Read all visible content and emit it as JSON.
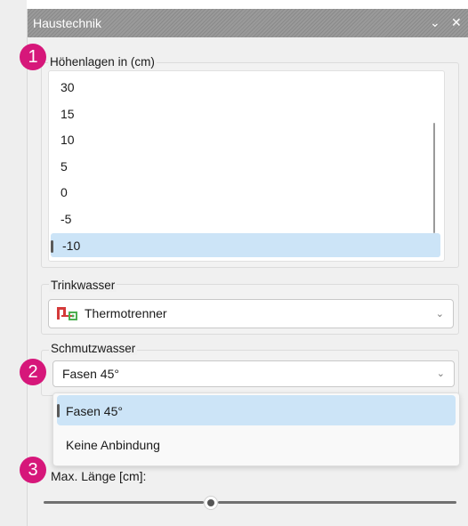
{
  "panel": {
    "title": "Haustechnik",
    "controls": {
      "pin_icon": "chevron-down-icon",
      "close_icon": "close-icon"
    }
  },
  "heights": {
    "label": "Höhenlagen in (cm)",
    "items": [
      "30",
      "15",
      "10",
      "5",
      "0",
      "-5",
      "-10"
    ],
    "selected": "-10"
  },
  "trinkwasser": {
    "label": "Trinkwasser",
    "value": "Thermotrenner",
    "icon": "thermotrenner-icon"
  },
  "schmutzwasser": {
    "label": "Schmutzwasser",
    "value": "Fasen 45°",
    "options": [
      "Fasen 45°",
      "Keine Anbindung"
    ],
    "selected": "Fasen 45°"
  },
  "slider": {
    "label": "Max. Länge [cm]:"
  },
  "callouts": [
    "1",
    "2",
    "3"
  ],
  "colors": {
    "accent_badge": "#d6177a",
    "selection": "#cce4f7",
    "titlebar": "#8f8f8f"
  }
}
